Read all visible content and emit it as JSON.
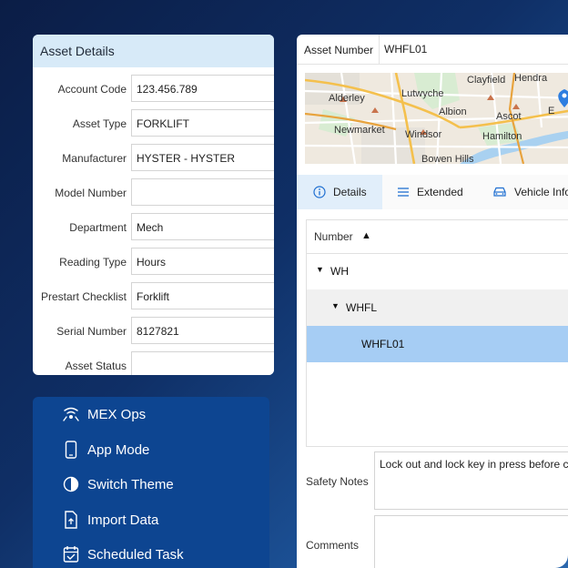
{
  "details": {
    "title": "Asset Details",
    "fields": [
      {
        "label": "Account Code",
        "value": "123.456.789"
      },
      {
        "label": "Asset Type",
        "value": "FORKLIFT"
      },
      {
        "label": "Manufacturer",
        "value": "HYSTER - HYSTER"
      },
      {
        "label": "Model Number",
        "value": ""
      },
      {
        "label": "Department",
        "value": "Mech"
      },
      {
        "label": "Reading Type",
        "value": "Hours"
      },
      {
        "label": "Prestart Checklist",
        "value": "Forklift"
      },
      {
        "label": "Serial Number",
        "value": "8127821"
      },
      {
        "label": "Asset Status",
        "value": ""
      }
    ]
  },
  "menu": {
    "items": [
      {
        "label": "MEX Ops",
        "icon": "satellite-icon"
      },
      {
        "label": "App Mode",
        "icon": "phone-icon"
      },
      {
        "label": "Switch Theme",
        "icon": "theme-icon"
      },
      {
        "label": "Import Data",
        "icon": "upload-file-icon"
      },
      {
        "label": "Scheduled Task",
        "icon": "calendar-task-icon"
      }
    ]
  },
  "asset": {
    "label": "Asset Number",
    "value": "WHFL01"
  },
  "map": {
    "places": [
      "Hendra",
      "Clayfield",
      "Alderley",
      "Lutwyche",
      "Albion",
      "Ascot",
      "Newmarket",
      "Windsor",
      "Hamilton",
      "Bowen Hills",
      "E"
    ]
  },
  "tabs": [
    {
      "label": "Details",
      "icon": "info-icon"
    },
    {
      "label": "Extended",
      "icon": "list-icon"
    },
    {
      "label": "Vehicle Info",
      "icon": "car-icon"
    }
  ],
  "tree": {
    "column": "Number",
    "sort_glyph": "▲",
    "rows": [
      {
        "label": "WH",
        "caret": "▼"
      },
      {
        "label": "WHFL",
        "caret": "▼"
      },
      {
        "label": "WHFL01",
        "caret": ""
      }
    ]
  },
  "safety": {
    "label": "Safety Notes",
    "value": "Lock out and lock key in press before commencing work"
  },
  "comments": {
    "label": "Comments",
    "value": ""
  },
  "colors": {
    "accent": "#0d4591",
    "selected_row": "#a6cdf4",
    "header_bg": "#d7eaf8"
  }
}
